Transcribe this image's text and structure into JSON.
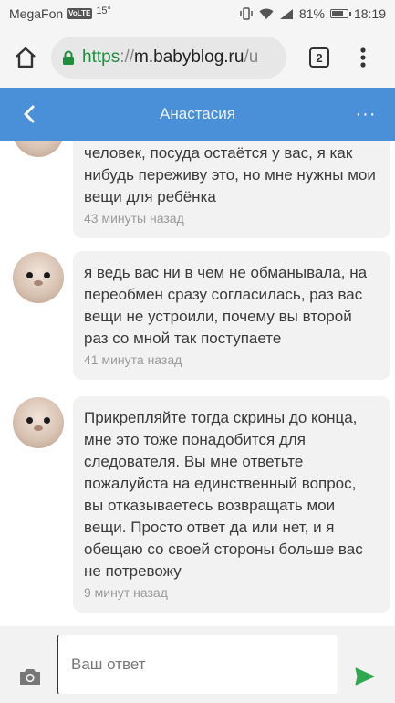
{
  "status_bar": {
    "carrier": "MegaFon",
    "volte_badge": "VoLTE",
    "temperature": "15°",
    "battery_percent": "81%",
    "battery_level": 0.81,
    "time": "18:19"
  },
  "browser": {
    "url_scheme": "https",
    "url_separator": "://",
    "url_host": "m.babyblog.ru",
    "url_path": "/u",
    "tab_count": "2"
  },
  "header": {
    "title": "Анастасия",
    "more_label": "···"
  },
  "messages": [
    {
      "text": "человек, посуда остаётся у вас, я как нибудь переживу это, но мне нужны мои вещи для ребёнка",
      "time": "43 минуты назад"
    },
    {
      "text": "я ведь вас ни в чем не обманывала, на переобмен сразу согласилась, раз вас вещи не устроили, почему вы второй раз со мной так поступаете",
      "time": "41 минута назад"
    },
    {
      "text": "Прикрепляйте тогда скрины до конца, мне это тоже понадобится для следователя. Вы мне ответьте пожалуйста на единственный вопрос, вы отказываетесь возвращать мои вещи. Просто ответ да или нет, и я обещаю со своей стороны больше вас не потревожу",
      "time": "9 минут назад"
    }
  ],
  "composer": {
    "placeholder": "Ваш ответ"
  },
  "colors": {
    "header_bg": "#4a90d9",
    "bubble_bg": "#f2f2f2",
    "send_icon": "#2fa84f",
    "secure_url": "#1e8e3e"
  },
  "icons": {
    "back": "chevron-left-icon",
    "home": "home-icon",
    "lock": "lock-icon",
    "menu": "vertical-dots-icon",
    "camera": "camera-icon",
    "send": "send-icon"
  }
}
